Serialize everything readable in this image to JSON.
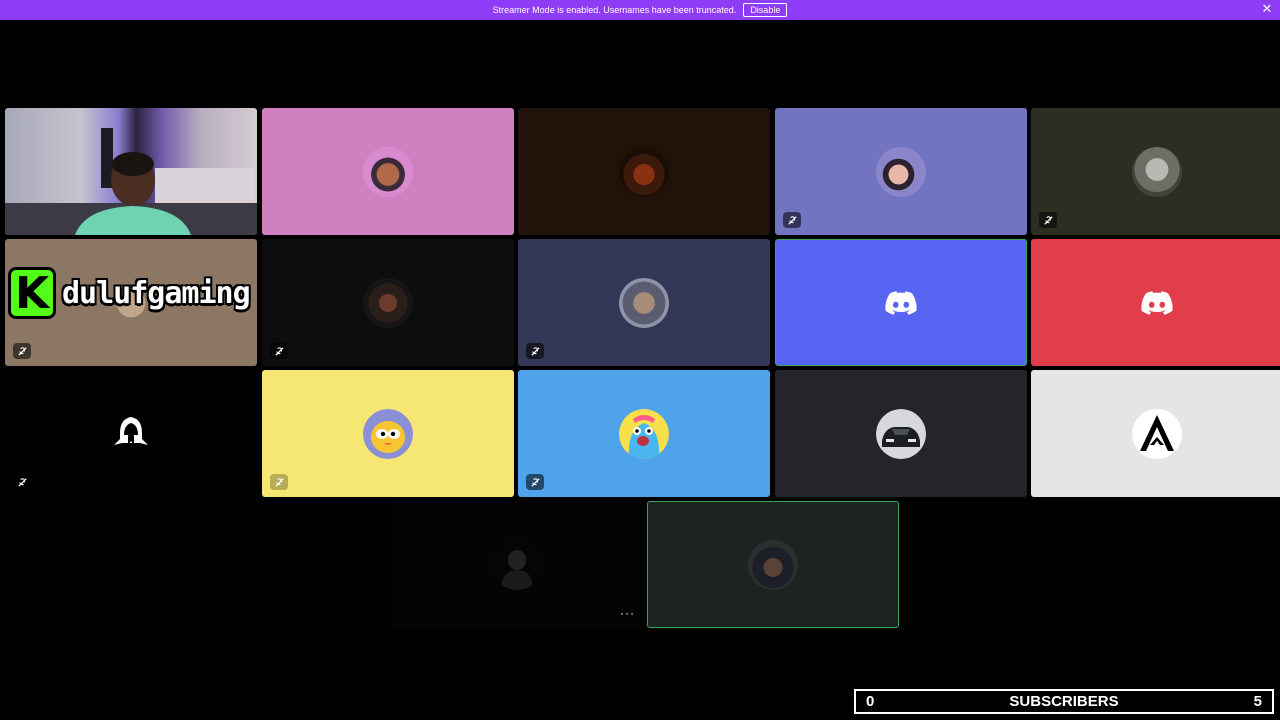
{
  "banner": {
    "text": "Streamer Mode is enabled. Usernames have been truncated.",
    "button_label": "Disable",
    "close_glyph": "✕"
  },
  "overlay": {
    "brand_letter": "K",
    "brand_name": "dulufgaming"
  },
  "more_glyph": "···",
  "subscribers": {
    "current": "0",
    "label": "SUBSCRIBERS",
    "goal": "5"
  },
  "colors": {
    "banner": "#8f3cf7",
    "discord_blurple": "#5865f2",
    "discord_red": "#e13d4b",
    "speaking_ring": "#3ba55d",
    "kick_green": "#53fc18"
  },
  "icons": [
    "muted-mic-icon",
    "discord-logo-icon",
    "close-icon",
    "more-icon"
  ]
}
